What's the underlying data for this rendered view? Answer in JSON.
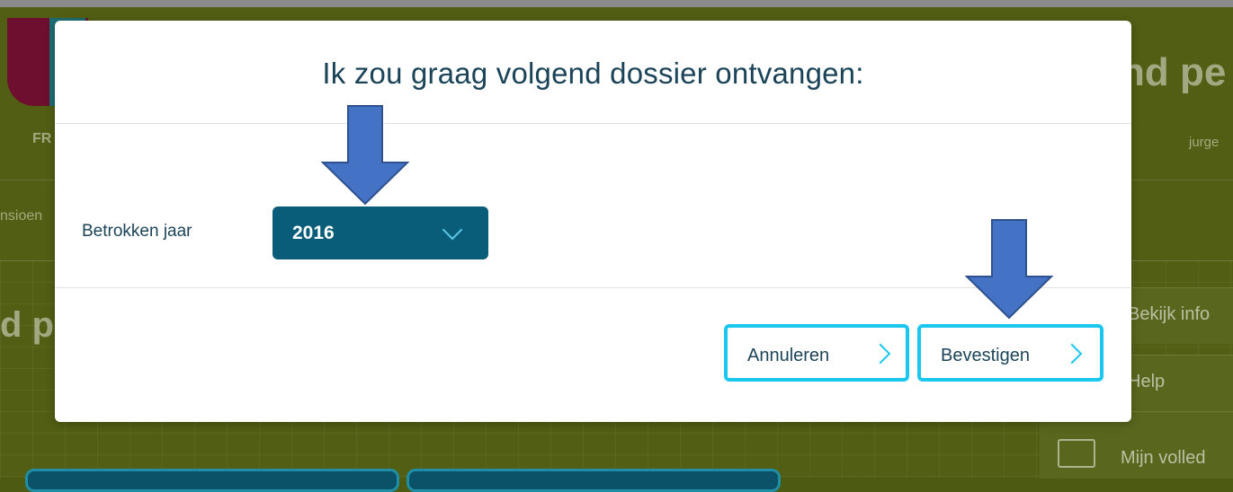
{
  "background": {
    "left_nav_fragment": "FR",
    "left_tab_fragment": "nsioen",
    "left_heading_fragment": "d p",
    "right_heading_fragment": "nd pe",
    "user_fragment": "jurge",
    "side_items": [
      {
        "label": "Bekijk info"
      },
      {
        "label": "Help"
      },
      {
        "label": "Mijn volled"
      }
    ]
  },
  "modal": {
    "title": "Ik zou graag volgend dossier ontvangen:",
    "year_field": {
      "label": "Betrokken jaar",
      "selected": "2016"
    },
    "buttons": {
      "cancel_label": "Annuleren",
      "confirm_label": "Bevestigen"
    }
  },
  "colors": {
    "accent": "#19c7ef",
    "select_bg": "#0a5d78",
    "title_text": "#1b4458",
    "annotation_arrow": "#4472c4"
  },
  "icons": {
    "select_chevron": "chevron-down-icon",
    "button_chevron": "chevron-right-icon",
    "printer": "printer-icon",
    "annotation": "down-arrow-annotation"
  }
}
